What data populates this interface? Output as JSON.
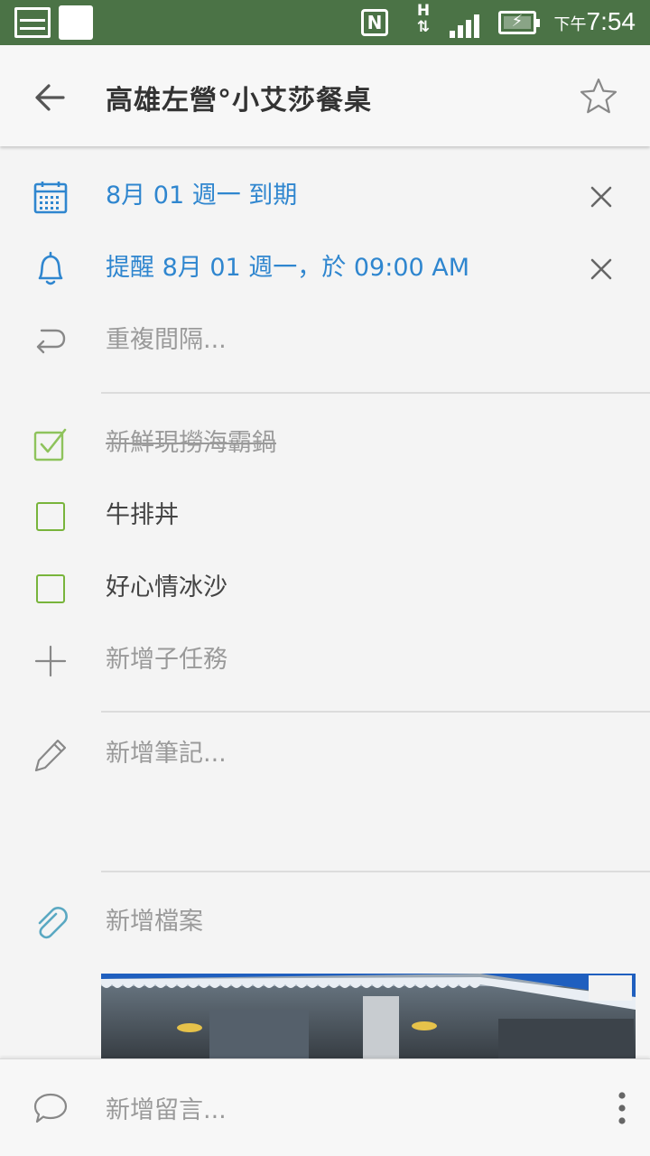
{
  "status_bar": {
    "net_type": "H",
    "time_prefix": "下午",
    "time": "7:54"
  },
  "header": {
    "title": "高雄左營°小艾莎餐桌"
  },
  "details": {
    "due_date": "8月 01 週一 到期",
    "reminder": "提醒 8月 01 週一，於 09:00 AM",
    "repeat_placeholder": "重複間隔..."
  },
  "subtasks": [
    {
      "label": "新鮮現撈海霸鍋",
      "completed": true
    },
    {
      "label": "牛排丼",
      "completed": false
    },
    {
      "label": "好心情冰沙",
      "completed": false
    }
  ],
  "add_subtask": "新增子任務",
  "note_placeholder": "新增筆記...",
  "add_file": "新增檔案",
  "comment_placeholder": "新增留言...",
  "colors": {
    "status_bar": "#4b7346",
    "accent_blue": "#2f86cf",
    "check_green": "#78b43b",
    "clip_teal": "#5aa8c2"
  }
}
